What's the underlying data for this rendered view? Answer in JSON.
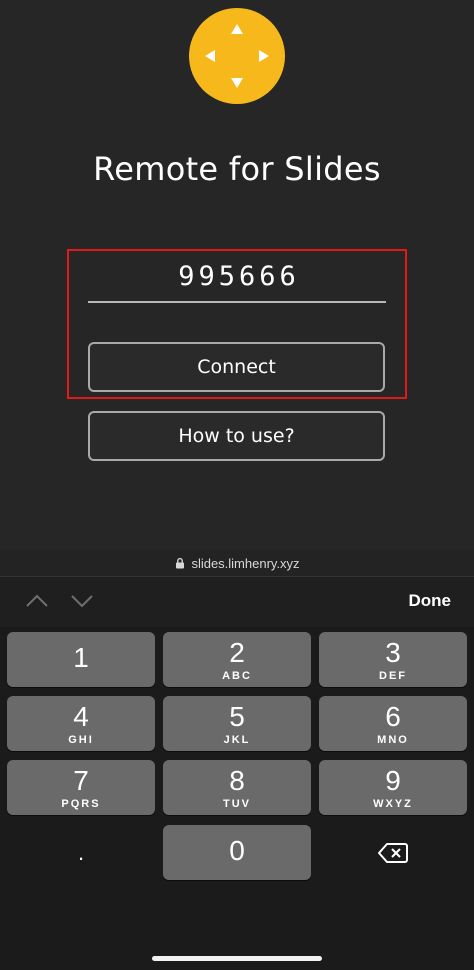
{
  "app": {
    "title": "Remote for Slides",
    "code_value": "995666",
    "connect_label": "Connect",
    "howto_label": "How to use?"
  },
  "browser": {
    "url": "slides.limhenry.xyz"
  },
  "accessory": {
    "done_label": "Done"
  },
  "keypad": {
    "keys": [
      {
        "num": "1",
        "letters": ""
      },
      {
        "num": "2",
        "letters": "ABC"
      },
      {
        "num": "3",
        "letters": "DEF"
      },
      {
        "num": "4",
        "letters": "GHI"
      },
      {
        "num": "5",
        "letters": "JKL"
      },
      {
        "num": "6",
        "letters": "MNO"
      },
      {
        "num": "7",
        "letters": "PQRS"
      },
      {
        "num": "8",
        "letters": "TUV"
      },
      {
        "num": "9",
        "letters": "WXYZ"
      },
      {
        "num": "0",
        "letters": ""
      }
    ],
    "dot_label": "."
  },
  "colors": {
    "brand": "#f7b81b",
    "highlight": "#e01a1a",
    "background": "#262626"
  }
}
